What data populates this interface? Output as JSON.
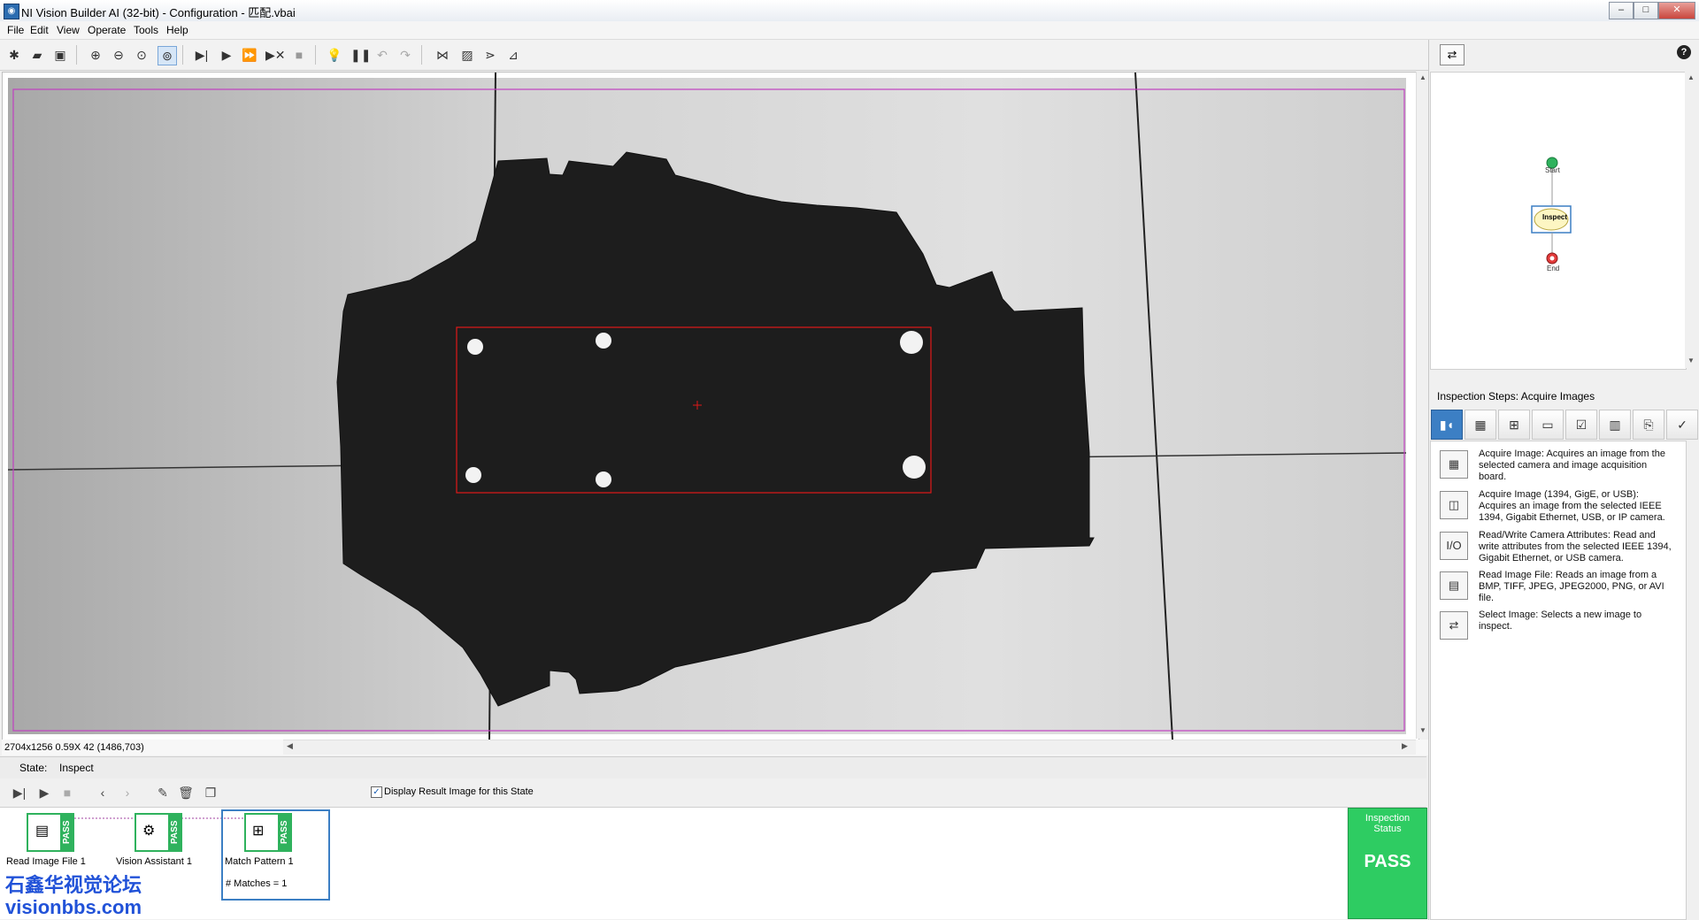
{
  "window": {
    "title": "NI Vision Builder AI (32-bit) - Configuration - 匹配.vbai"
  },
  "menu": [
    "File",
    "Edit",
    "View",
    "Operate",
    "Tools",
    "Help"
  ],
  "image_info": {
    "readout": "2704x1256 0.59X 42    (1486,703)"
  },
  "state": {
    "label": "State:",
    "value": "Inspect"
  },
  "display_result": {
    "label": "Display Result Image for this State",
    "checked": true
  },
  "steps": [
    {
      "label": "Read Image File 1",
      "status": "PASS"
    },
    {
      "label": "Vision Assistant 1",
      "status": "PASS"
    },
    {
      "label": "Match Pattern 1",
      "status": "PASS",
      "detail": "# Matches = 1"
    }
  ],
  "inspection_status": {
    "label": "Inspection Status",
    "value": "PASS"
  },
  "flow": {
    "start": "Start",
    "state": "Inspect",
    "end": "End"
  },
  "inspection_steps": {
    "header": "Inspection Steps: Acquire Images",
    "items": [
      {
        "icon": "IMAQ",
        "name": "Acquire Image:",
        "desc": "Acquires an image from the selected camera and image acquisition board."
      },
      {
        "icon": "IMAQdx",
        "name": "Acquire Image (1394, GigE, or USB):",
        "desc": "Acquires an image from the selected IEEE 1394, Gigabit Ethernet, USB, or IP camera."
      },
      {
        "icon": "I/O",
        "name": "Read/Write Camera Attributes:",
        "desc": "Read and write attributes from the selected IEEE 1394, Gigabit Ethernet, or USB camera."
      },
      {
        "icon": "file",
        "name": "Read Image File:",
        "desc": "Reads an image from a BMP, TIFF, JPEG, JPEG2000, PNG, or AVI file."
      },
      {
        "icon": "select",
        "name": "Select Image:",
        "desc": "Selects a new image to inspect."
      }
    ]
  },
  "watermark": {
    "line1": "石鑫华视觉论坛",
    "line2": "visionbbs.com"
  },
  "colors": {
    "pass_green": "#2ecc62",
    "roi_red": "#e01818",
    "border_magenta": "#c040c0",
    "tab_blue": "#3c7fc4"
  }
}
